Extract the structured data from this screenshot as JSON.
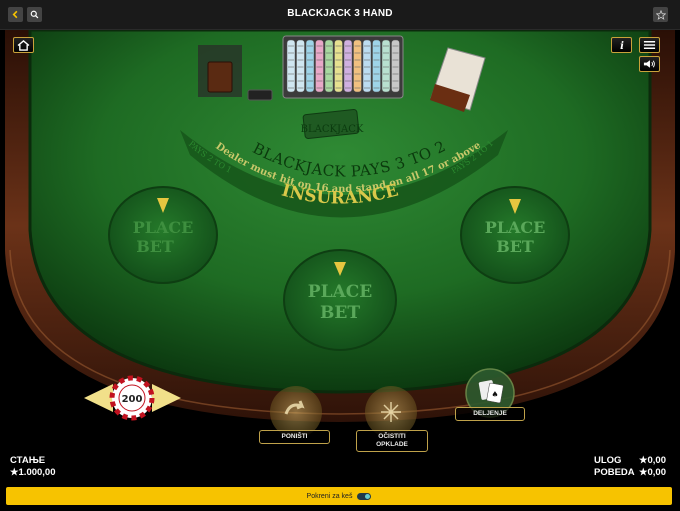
{
  "top_bar": {
    "title": "BLACKJACK 3 HAND",
    "back_icon": "chevron-left-icon",
    "search_icon": "search-icon",
    "favorite_icon": "star-icon"
  },
  "table_controls": {
    "home_icon": "home-icon",
    "info_icon": "info-icon",
    "menu_icon": "menu-icon",
    "sound_icon": "speaker-icon"
  },
  "felt": {
    "logo": "BLACKJACK",
    "banner_line1": "BLACKJACK PAYS 3 TO 2",
    "banner_line2": "Dealer must hit on 16 and stand on all 17 or above",
    "side_left": "PAYS 2 TO 1",
    "side_right": "PAYS 2 TO 1",
    "insurance": "INSURANCE",
    "spots": [
      {
        "line1": "PLACE",
        "line2": "BET"
      },
      {
        "line1": "PLACE",
        "line2": "BET"
      },
      {
        "line1": "PLACE",
        "line2": "BET"
      }
    ]
  },
  "chip_selector": {
    "value": "200"
  },
  "actions": {
    "clear": "PONIŠTI",
    "clear_bets_line1": "OČISTITI",
    "clear_bets_line2": "OPKLADE",
    "deal": "DELJENJE"
  },
  "footer": {
    "balance_label": "СТАЊЕ",
    "balance_value": "★1.000,00",
    "bet_label": "ULOG",
    "bet_value": "★0,00",
    "win_label": "POBEDA",
    "win_value": "★0,00"
  },
  "bottom_bar": {
    "autodeal_label": "Pokreni za keš"
  },
  "colors": {
    "felt": "#1e6b23",
    "rail": "#5a2a17",
    "accent": "#f7c300",
    "gold": "#c9a23a"
  }
}
